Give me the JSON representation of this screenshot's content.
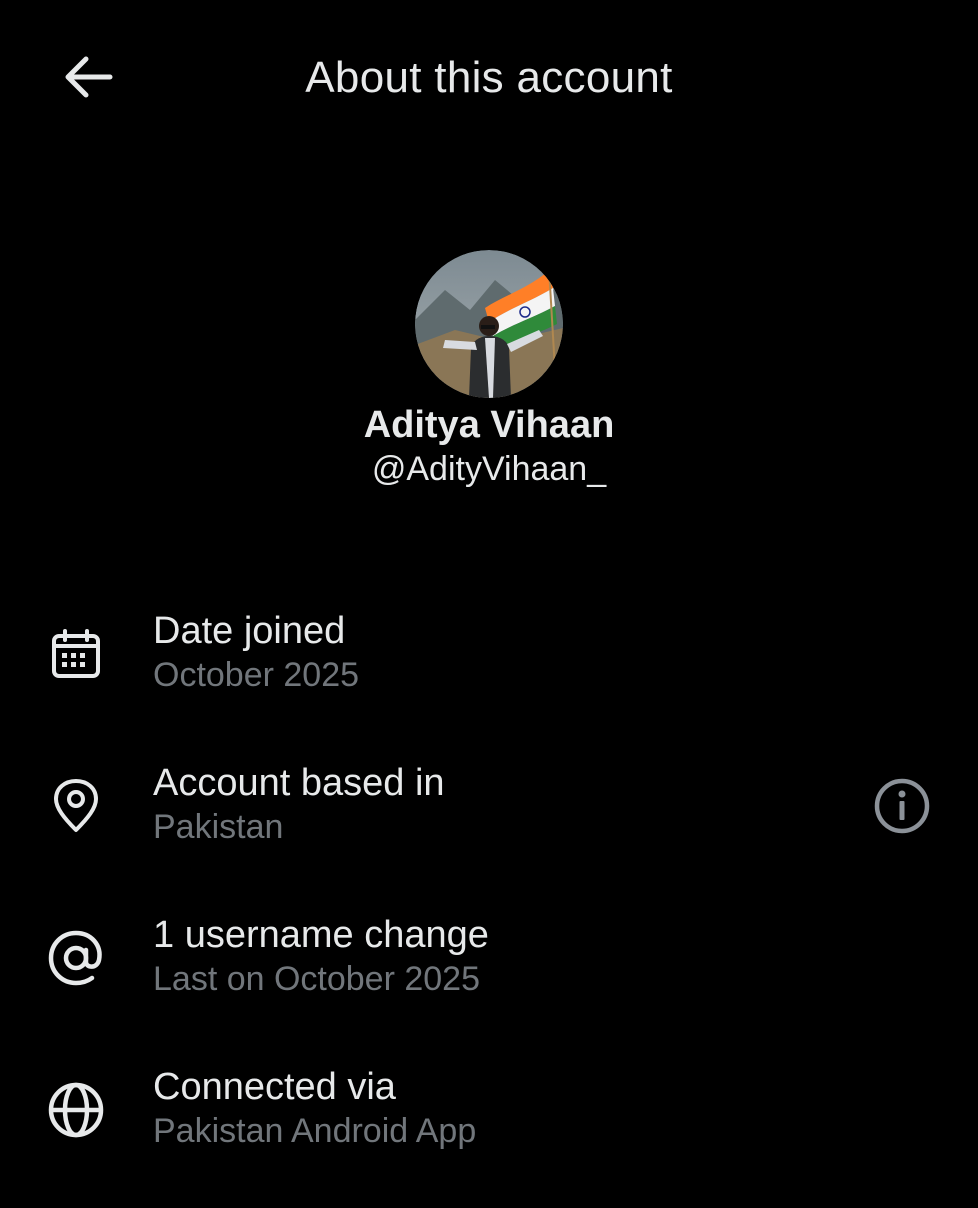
{
  "header": {
    "title": "About this account",
    "back_icon": "arrow-left-icon"
  },
  "profile": {
    "display_name": "Aditya Vihaan",
    "handle": "@AdityVihaan_"
  },
  "info": [
    {
      "icon": "calendar-icon",
      "title": "Date joined",
      "subtitle": "October 2025"
    },
    {
      "icon": "location-pin-icon",
      "title": "Account based in",
      "subtitle": "Pakistan"
    },
    {
      "icon": "at-sign-icon",
      "title": "1 username change",
      "subtitle": "Last on October 2025"
    },
    {
      "icon": "globe-icon",
      "title": "Connected via",
      "subtitle": "Pakistan Android App"
    }
  ],
  "colors": {
    "background": "#000000",
    "primary_text": "#e7e9ea",
    "secondary_text": "#71767b"
  }
}
